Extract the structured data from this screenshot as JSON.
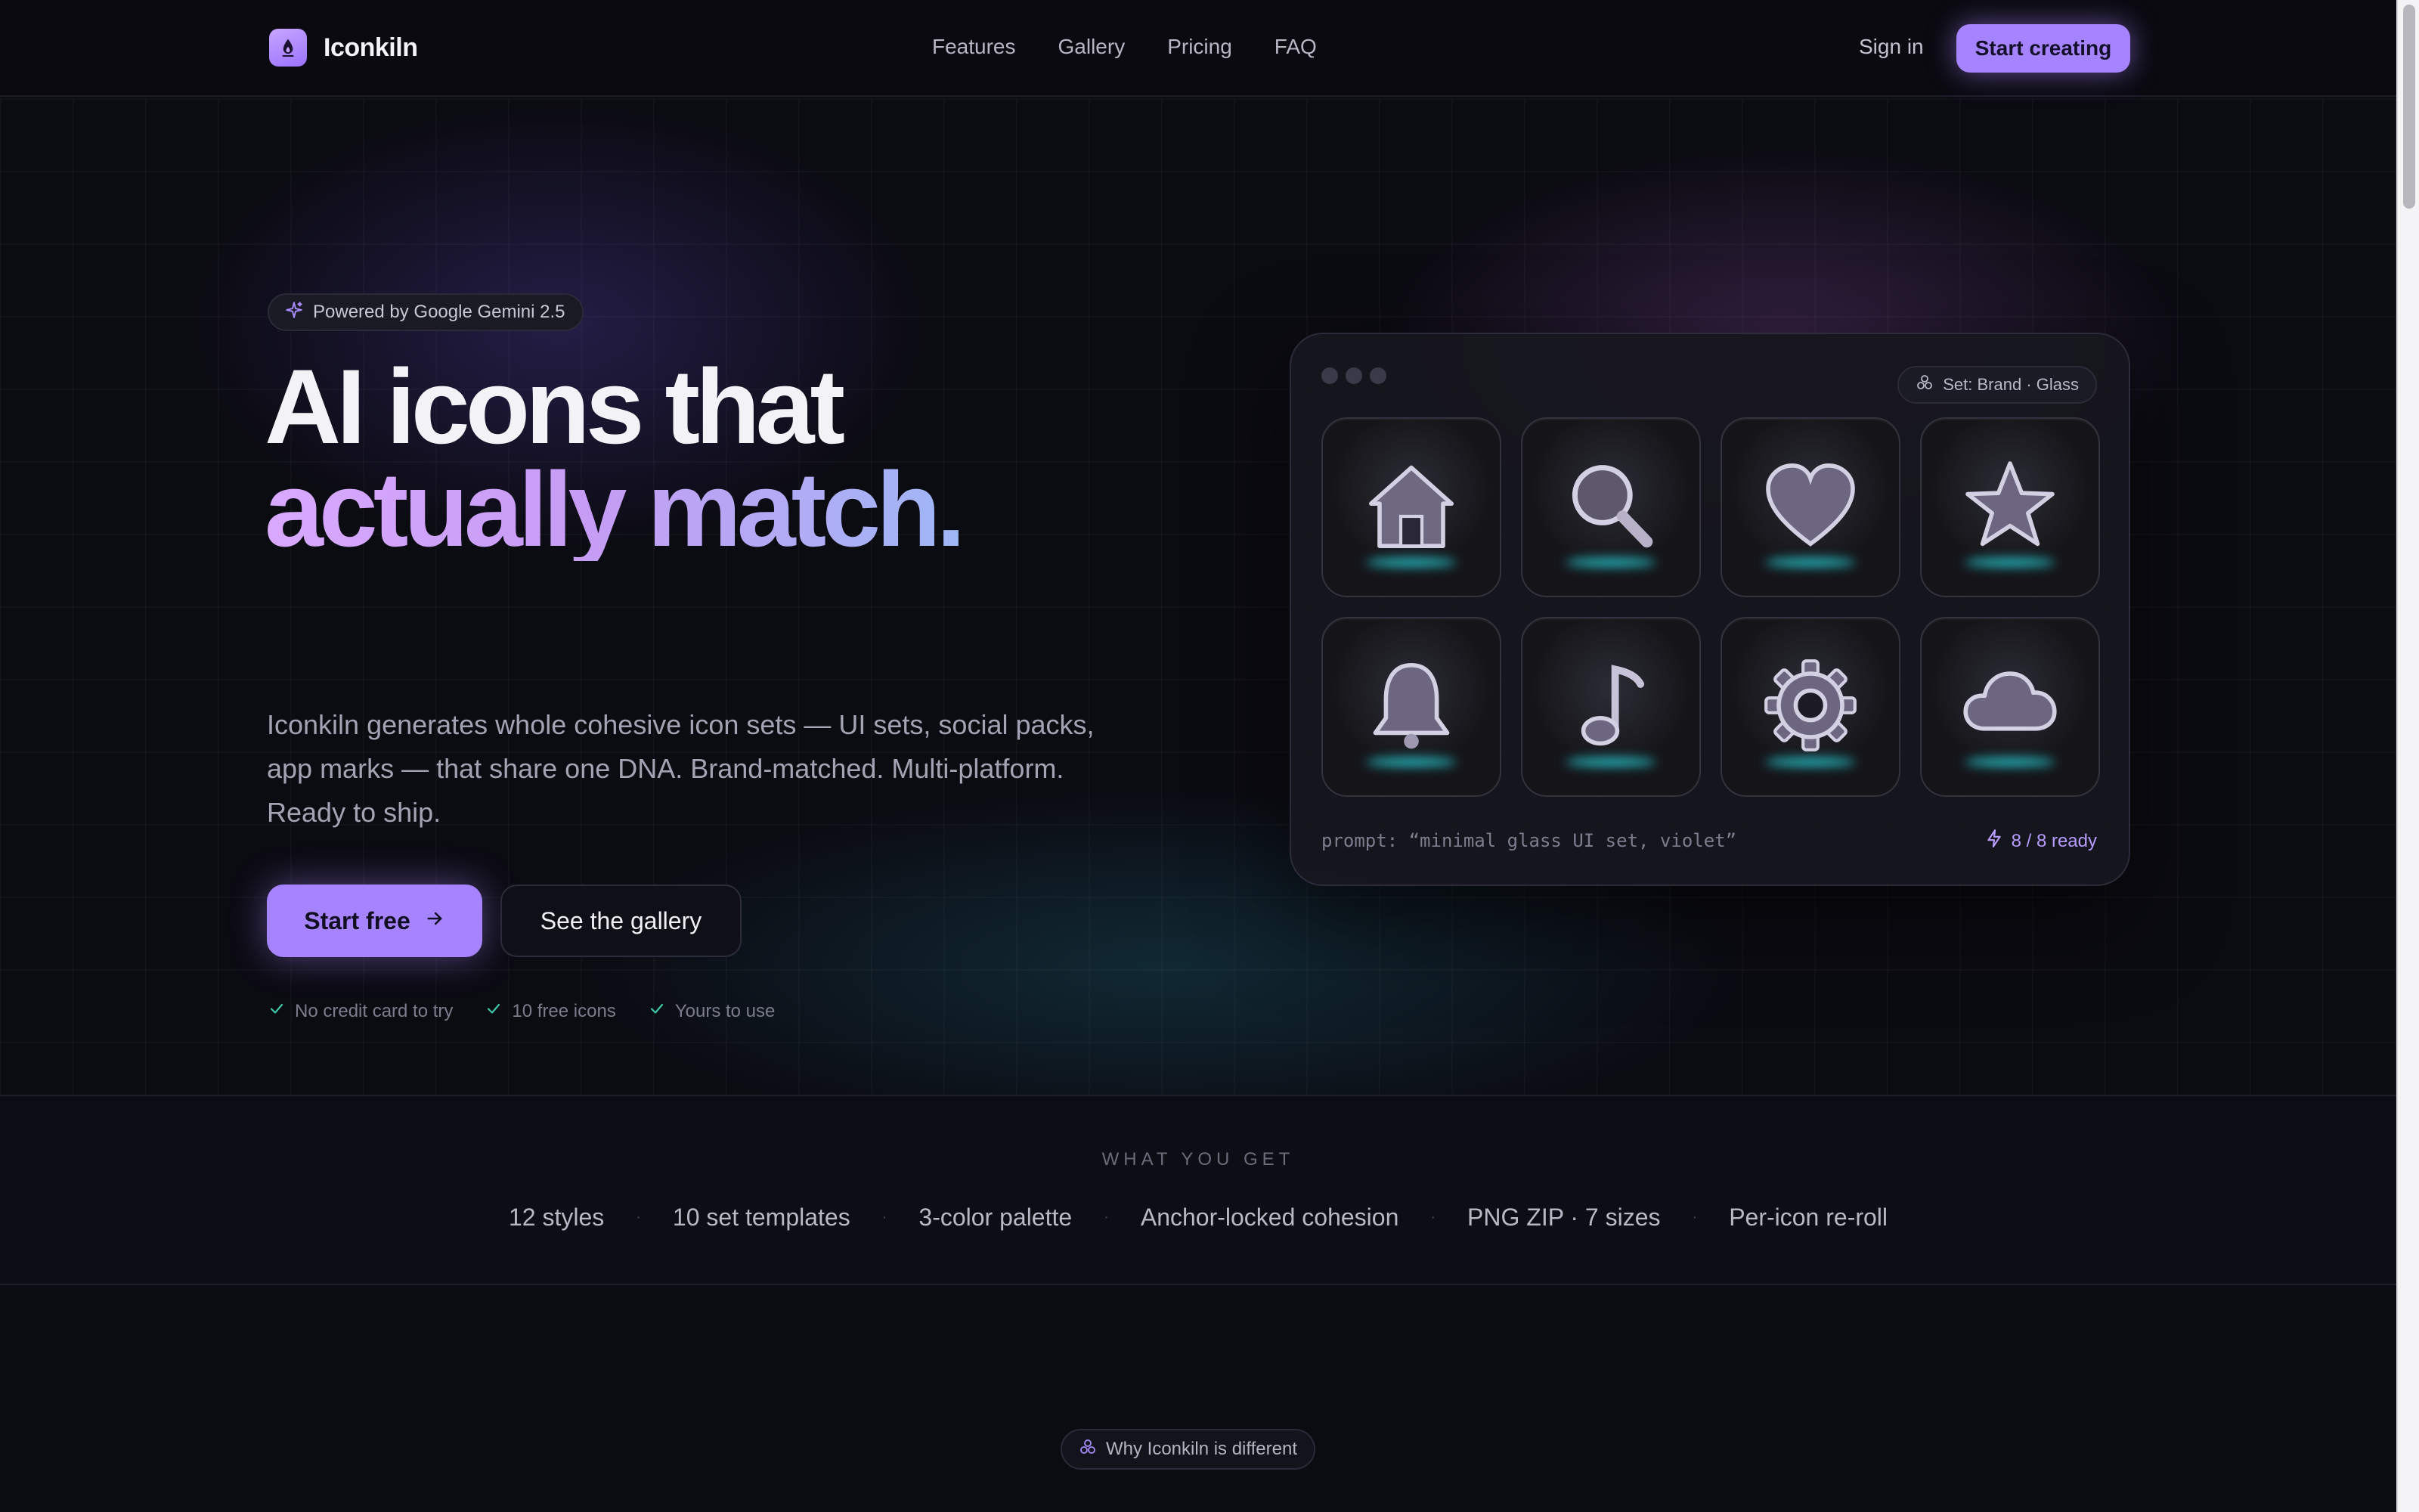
{
  "header": {
    "brand": "Iconkiln",
    "nav": [
      "Features",
      "Gallery",
      "Pricing",
      "FAQ"
    ],
    "sign_in": "Sign in",
    "cta": "Start creating"
  },
  "hero": {
    "badge": "Powered by Google Gemini 2.5",
    "headline_line1": "AI icons that",
    "headline_line2": "actually match.",
    "subcopy": "Iconkiln generates whole cohesive icon sets — UI sets, social packs, app marks — that share one DNA. Brand-matched. Multi-platform. Ready to ship.",
    "primary_button": "Start free",
    "secondary_button": "See the gallery",
    "perks": [
      "No credit card to try",
      "10 free icons",
      "Yours to use"
    ]
  },
  "preview": {
    "set_label": "Set: Brand · Glass",
    "icons": [
      "home-icon",
      "search-icon",
      "heart-icon",
      "star-icon",
      "bell-icon",
      "music-note-icon",
      "gear-icon",
      "cloud-icon"
    ],
    "prompt": "prompt: “minimal glass UI set, violet”",
    "status": "8 / 8 ready"
  },
  "what_you_get": {
    "label": "WHAT YOU GET",
    "items": [
      "12 styles",
      "10 set templates",
      "3-color palette",
      "Anchor-locked cohesion",
      "PNG ZIP · 7 sizes",
      "Per-icon re-roll"
    ],
    "separator": "·"
  },
  "why": {
    "label": "Why Iconkiln is different"
  },
  "colors": {
    "accent": "#a784ff",
    "glow": "#29d3dc",
    "background": "#0b0b12"
  }
}
